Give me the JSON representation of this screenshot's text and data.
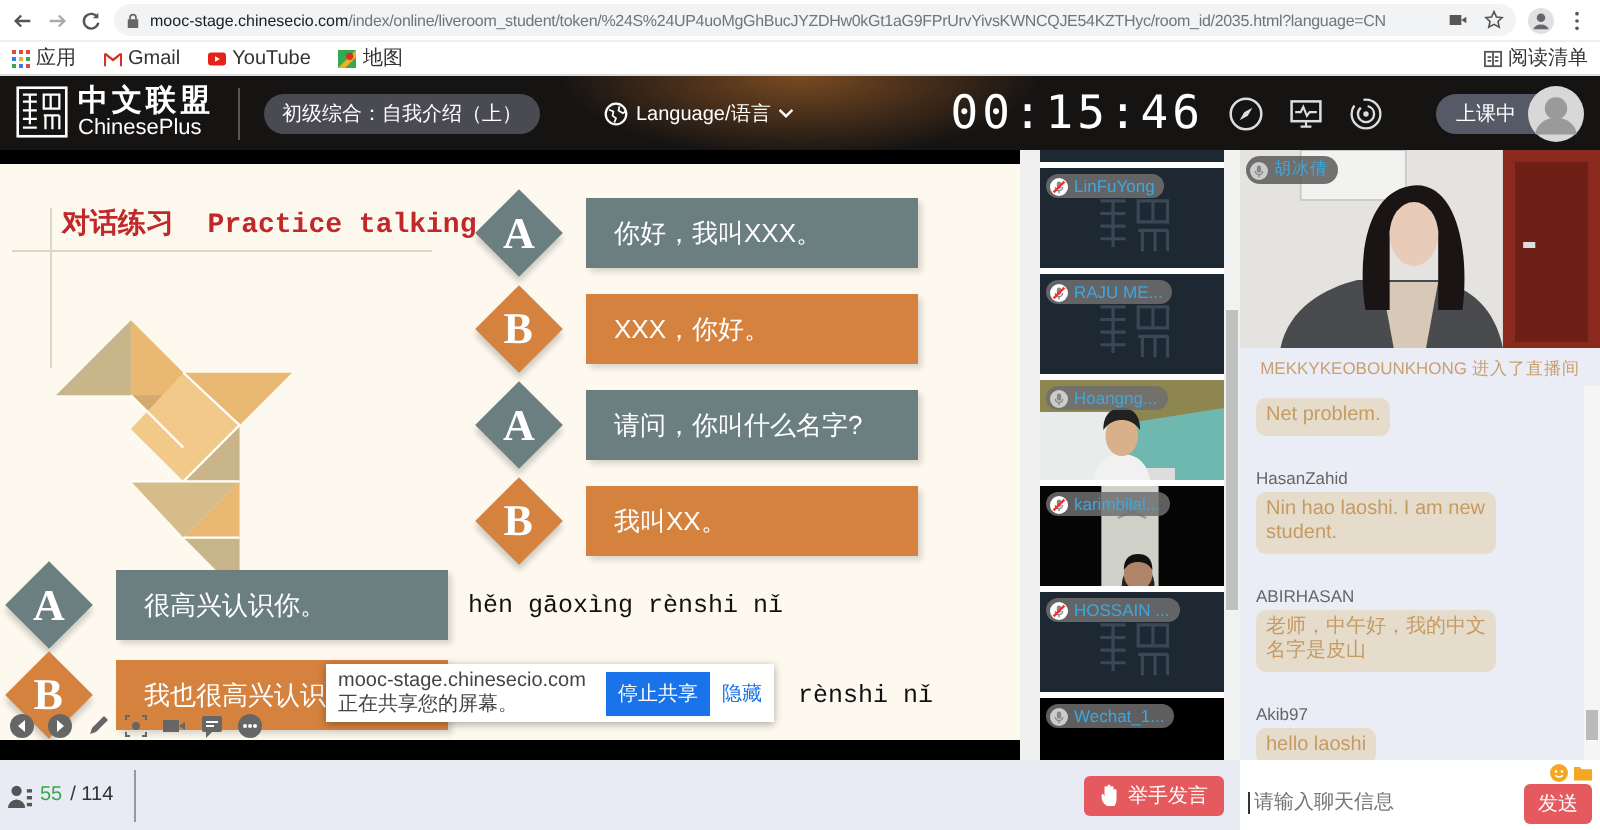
{
  "browser": {
    "url_host": "mooc-stage.chinesecio.com",
    "url_path": "/index/online/liveroom_student/token/%24S%24UP4uoMgGhBucJYZDHw0kGt1aG9FPrUrvYivsKWNCQJE54KZTHyc/room_id/2035.html?language=CN",
    "bookmarks": [
      "应用",
      "Gmail",
      "YouTube",
      "地图"
    ],
    "reading_list": "阅读清单"
  },
  "header": {
    "logo_cn": "中文联盟",
    "logo_en": "ChinesePlus",
    "course": "初级综合：自我介绍（上）",
    "language": "Language/语言",
    "timer": "00:15:46",
    "status": "上课中"
  },
  "slide": {
    "title_cn": "对话练习",
    "title_en": "Practice talking",
    "dialog": [
      {
        "speaker": "A",
        "text": "你好，我叫XXX。",
        "color": "#6b7f80"
      },
      {
        "speaker": "B",
        "text": "XXX，你好。",
        "color": "#d4823e"
      },
      {
        "speaker": "A",
        "text": "请问，你叫什么名字?",
        "color": "#6b7f80"
      },
      {
        "speaker": "B",
        "text": "我叫XX。",
        "color": "#d4823e"
      }
    ],
    "bottom_dialog": [
      {
        "speaker": "A",
        "text": "很高兴认识你。",
        "pinyin": "hěn gāoxìng rènshi nǐ",
        "color": "#6b7f80"
      },
      {
        "speaker": "B",
        "text": "我也很高兴认识",
        "pinyin": "rènshi nǐ",
        "color": "#d4823e"
      }
    ]
  },
  "share_notice": {
    "text": "mooc-stage.chinesecio.com正在共享您的屏幕。",
    "stop": "停止共享",
    "hide": "隐藏"
  },
  "participants": [
    {
      "name": "LinFuYong",
      "muted": true,
      "kind": "logo"
    },
    {
      "name": "RAJU ME...",
      "muted": true,
      "kind": "logo"
    },
    {
      "name": "Hoangng...",
      "muted": false,
      "kind": "video"
    },
    {
      "name": "karimbilal...",
      "muted": true,
      "kind": "video"
    },
    {
      "name": "HOSSAIN ...",
      "muted": true,
      "kind": "logo"
    },
    {
      "name": "Wechat_1...",
      "muted": false,
      "kind": "blank"
    }
  ],
  "teacher": {
    "name": "胡冰倩",
    "muted": false
  },
  "chat": {
    "notice": "MEKKYKEOBOUNKHONG 进入了直播间",
    "messages": [
      {
        "text": "Net problem."
      },
      {
        "sender": "HasanZahid",
        "text": "Nin hao laoshi. I am new student."
      },
      {
        "sender": "ABIRHASAN",
        "text": "老师，中午好，我的中文名字是皮山"
      },
      {
        "sender": "Akib97",
        "text": "hello laoshi"
      }
    ],
    "placeholder": "请输入聊天信息",
    "send": "发送"
  },
  "footer": {
    "online": "55",
    "total": "/ 114",
    "raise_hand": "举手发言"
  }
}
